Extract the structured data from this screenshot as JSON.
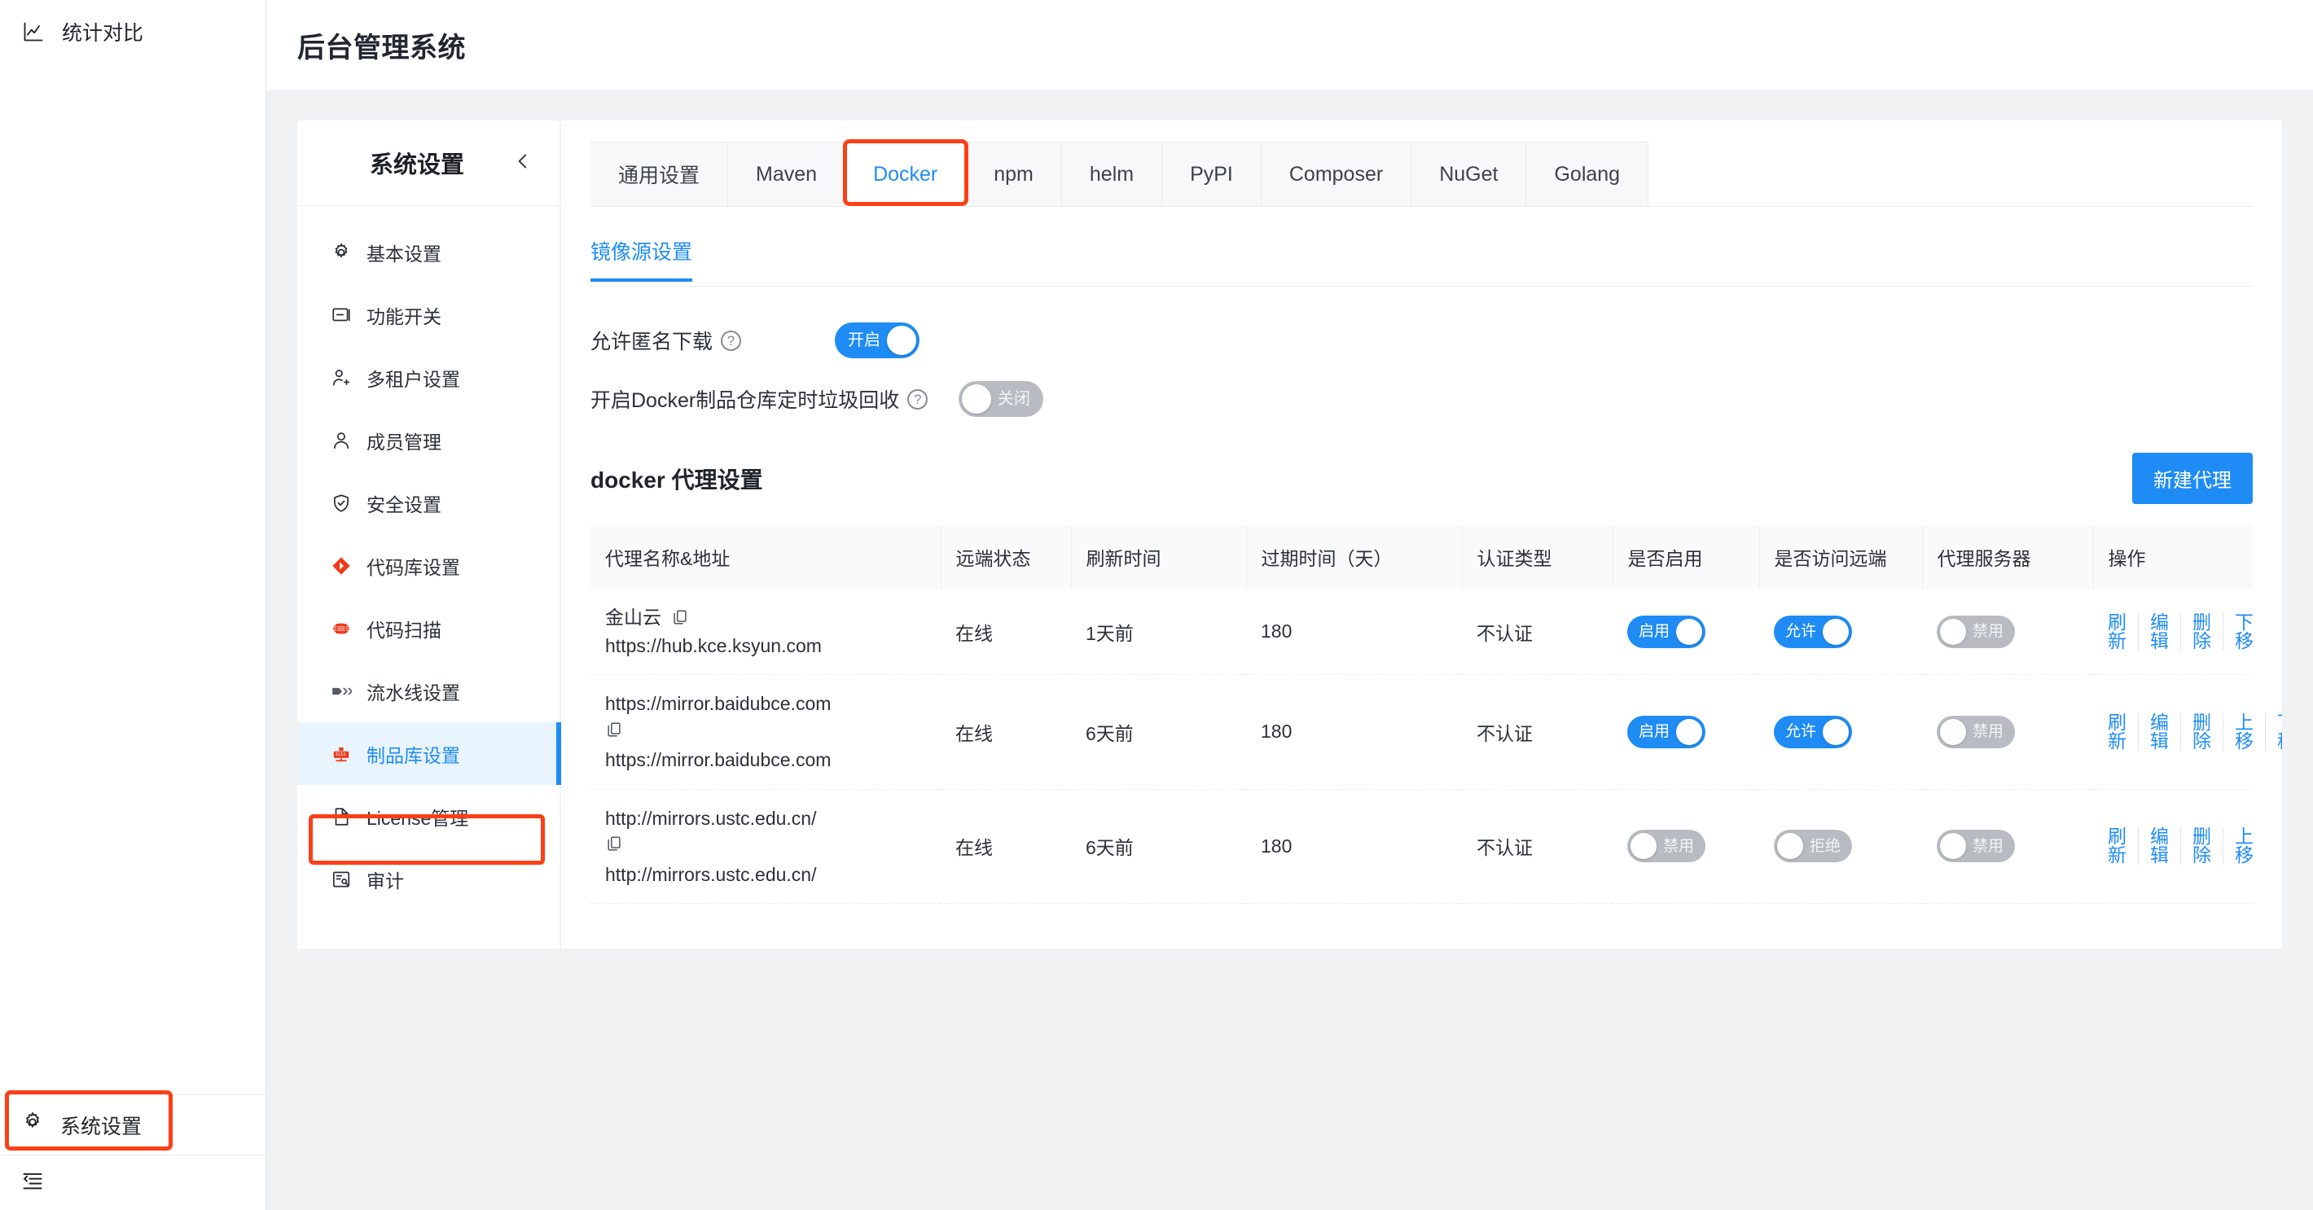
{
  "left_nav": {
    "top_item": {
      "label": "统计对比",
      "icon": "chart-line-icon"
    },
    "bottom_item": {
      "label": "系统设置",
      "icon": "gear-icon"
    },
    "collapse_icon": "menu-collapse-icon"
  },
  "header": {
    "title": "后台管理系统"
  },
  "settings_sidebar": {
    "title": "系统设置",
    "collapse_icon": "chevron-left-icon",
    "items": [
      {
        "label": "基本设置",
        "icon": "gear-icon",
        "active": false
      },
      {
        "label": "功能开关",
        "icon": "toggle-box-icon",
        "active": false
      },
      {
        "label": "多租户设置",
        "icon": "user-add-icon",
        "active": false
      },
      {
        "label": "成员管理",
        "icon": "user-icon",
        "active": false
      },
      {
        "label": "安全设置",
        "icon": "shield-check-icon",
        "active": false
      },
      {
        "label": "代码库设置",
        "icon": "git-repo-icon",
        "active": false
      },
      {
        "label": "代码扫描",
        "icon": "code-scan-icon",
        "active": false
      },
      {
        "label": "流水线设置",
        "icon": "pipeline-icon",
        "active": false
      },
      {
        "label": "制品库设置",
        "icon": "artifact-icon",
        "active": true
      },
      {
        "label": "License管理",
        "icon": "file-icon",
        "active": false
      },
      {
        "label": "审计",
        "icon": "audit-icon",
        "active": false
      }
    ]
  },
  "tabs": [
    {
      "label": "通用设置",
      "active": false
    },
    {
      "label": "Maven",
      "active": false
    },
    {
      "label": "Docker",
      "active": true
    },
    {
      "label": "npm",
      "active": false
    },
    {
      "label": "helm",
      "active": false
    },
    {
      "label": "PyPI",
      "active": false
    },
    {
      "label": "Composer",
      "active": false
    },
    {
      "label": "NuGet",
      "active": false
    },
    {
      "label": "Golang",
      "active": false
    }
  ],
  "subtab": {
    "label": "镜像源设置",
    "active": true
  },
  "options": [
    {
      "label": "允许匿名下载",
      "help_icon": "question-circle-icon",
      "switch": {
        "state": "on",
        "text": "开启"
      }
    },
    {
      "label": "开启Docker制品仓库定时垃圾回收",
      "help_icon": "question-circle-icon",
      "switch": {
        "state": "off",
        "text": "关闭"
      }
    }
  ],
  "proxy_section": {
    "title": "docker 代理设置",
    "new_button": "新建代理"
  },
  "table": {
    "columns": [
      "代理名称&地址",
      "远端状态",
      "刷新时间",
      "过期时间（天）",
      "认证类型",
      "是否启用",
      "是否访问远端",
      "代理服务器",
      "操作"
    ],
    "rows": [
      {
        "name": "金山云",
        "copy_icon": "copy-icon",
        "address": "https://hub.kce.ksyun.com",
        "remote_status": "在线",
        "refresh_time": "1天前",
        "expire_days": "180",
        "auth_type": "不认证",
        "enabled": {
          "state": "on",
          "text": "启用"
        },
        "access_remote": {
          "state": "on",
          "text": "允许"
        },
        "proxy_server": {
          "state": "off",
          "text": "禁用"
        },
        "actions": [
          "刷新",
          "编辑",
          "删除",
          "下移"
        ]
      },
      {
        "name": "https://mirror.baidubce.com",
        "copy_icon": "copy-icon",
        "address": "https://mirror.baidubce.com",
        "remote_status": "在线",
        "refresh_time": "6天前",
        "expire_days": "180",
        "auth_type": "不认证",
        "enabled": {
          "state": "on",
          "text": "启用"
        },
        "access_remote": {
          "state": "on",
          "text": "允许"
        },
        "proxy_server": {
          "state": "off",
          "text": "禁用"
        },
        "actions": [
          "刷新",
          "编辑",
          "删除",
          "上移",
          "下移"
        ]
      },
      {
        "name": "http://mirrors.ustc.edu.cn/",
        "copy_icon": "copy-icon",
        "address": "http://mirrors.ustc.edu.cn/",
        "remote_status": "在线",
        "refresh_time": "6天前",
        "expire_days": "180",
        "auth_type": "不认证",
        "enabled": {
          "state": "off",
          "text": "禁用"
        },
        "access_remote": {
          "state": "off",
          "text": "拒绝"
        },
        "proxy_server": {
          "state": "off",
          "text": "禁用"
        },
        "actions": [
          "刷新",
          "编辑",
          "删除",
          "上移"
        ]
      }
    ]
  },
  "colors": {
    "accent_blue": "#1f8cf5",
    "highlight_red": "#fc3f16",
    "active_menu_bg": "#e8f4fe",
    "page_bg": "#f1f2f4",
    "switch_off": "#b8bcc2"
  }
}
